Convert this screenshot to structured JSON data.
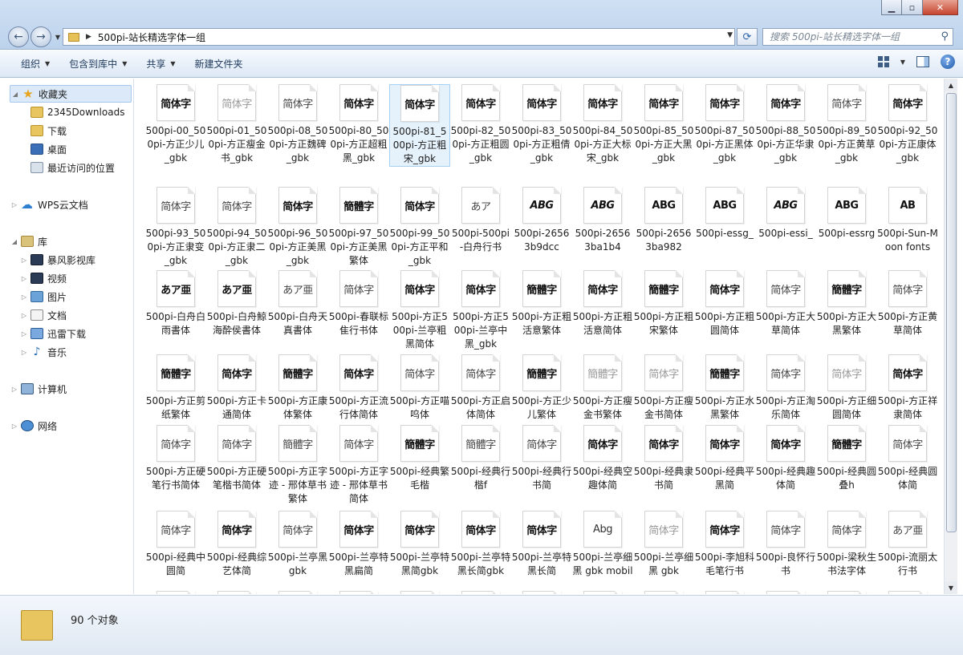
{
  "window": {
    "path_title": "500pi-站长精选字体一组",
    "search_placeholder": "搜索 500pi-站长精选字体一组"
  },
  "toolbar": {
    "organize": "组织",
    "include_in_library": "包含到库中",
    "share": "共享",
    "new_folder": "新建文件夹"
  },
  "sidebar": {
    "favorites": "收藏夹",
    "fav_items": [
      "2345Downloads",
      "下载",
      "桌面",
      "最近访问的位置"
    ],
    "wps": "WPS云文档",
    "libraries": "库",
    "lib_items": [
      "暴风影视库",
      "视频",
      "图片",
      "文档",
      "迅雷下载",
      "音乐"
    ],
    "computer": "计算机",
    "network": "网络"
  },
  "files": [
    {
      "name": "500pi-00_500pi-方正少儿_gbk",
      "glyph": "简体字",
      "style": ""
    },
    {
      "name": "500pi-01_500pi-方正瘦金书_gbk",
      "glyph": "简体字",
      "style": "light"
    },
    {
      "name": "500pi-08_500pi-方正魏碑_gbk",
      "glyph": "简体字",
      "style": "mid"
    },
    {
      "name": "500pi-80_500pi-方正超粗黑_gbk",
      "glyph": "简体字",
      "style": ""
    },
    {
      "name": "500pi-81_500pi-方正粗宋_gbk",
      "glyph": "简体字",
      "style": ""
    },
    {
      "name": "500pi-82_500pi-方正粗圆_gbk",
      "glyph": "简体字",
      "style": ""
    },
    {
      "name": "500pi-83_500pi-方正粗倩_gbk",
      "glyph": "简体字",
      "style": ""
    },
    {
      "name": "500pi-84_500pi-方正大标宋_gbk",
      "glyph": "简体字",
      "style": ""
    },
    {
      "name": "500pi-85_500pi-方正大黑_gbk",
      "glyph": "简体字",
      "style": ""
    },
    {
      "name": "500pi-87_500pi-方正黑体_gbk",
      "glyph": "简体字",
      "style": ""
    },
    {
      "name": "500pi-88_500pi-方正华隶_gbk",
      "glyph": "简体字",
      "style": ""
    },
    {
      "name": "500pi-89_500pi-方正黄草_gbk",
      "glyph": "简体字",
      "style": "mid"
    },
    {
      "name": "500pi-92_500pi-方正康体_gbk",
      "glyph": "简体字",
      "style": ""
    },
    {
      "name": "500pi-93_500pi-方正隶变_gbk",
      "glyph": "简体字",
      "style": "mid"
    },
    {
      "name": "500pi-94_500pi-方正隶二_gbk",
      "glyph": "简体字",
      "style": "mid"
    },
    {
      "name": "500pi-96_500pi-方正美黑_gbk",
      "glyph": "简体字",
      "style": ""
    },
    {
      "name": "500pi-97_500pi-方正美黑繁体",
      "glyph": "簡體字",
      "style": ""
    },
    {
      "name": "500pi-99_500pi-方正平和_gbk",
      "glyph": "简体字",
      "style": ""
    },
    {
      "name": "500pi-500pi-白舟行书",
      "glyph": "あア",
      "style": "mid"
    },
    {
      "name": "500pi-26563b9dcc",
      "glyph": "ABG",
      "style": "latin"
    },
    {
      "name": "500pi-26563ba1b4",
      "glyph": "ABG",
      "style": "latin"
    },
    {
      "name": "500pi-26563ba982",
      "glyph": "ABG",
      "style": ""
    },
    {
      "name": "500pi-essg_",
      "glyph": "ABG",
      "style": ""
    },
    {
      "name": "500pi-essi_",
      "glyph": "ABG",
      "style": "latin"
    },
    {
      "name": "500pi-essrg",
      "glyph": "ABG",
      "style": ""
    },
    {
      "name": "500pi-Sun-Moon fonts",
      "glyph": "AB",
      "style": ""
    },
    {
      "name": "500pi-白舟白雨書体",
      "glyph": "あア亜",
      "style": ""
    },
    {
      "name": "500pi-白舟鯨海酔侯書体",
      "glyph": "あア亜",
      "style": ""
    },
    {
      "name": "500pi-白舟天真書体",
      "glyph": "あア亜",
      "style": "mid"
    },
    {
      "name": "500pi-春联标隹行书体",
      "glyph": "简体字",
      "style": "mid"
    },
    {
      "name": "500pi-方正500pi-兰亭粗黑简体",
      "glyph": "简体字",
      "style": ""
    },
    {
      "name": "500pi-方正500pi-兰亭中黑_gbk",
      "glyph": "简体字",
      "style": ""
    },
    {
      "name": "500pi-方正粗活意繁体",
      "glyph": "簡體字",
      "style": ""
    },
    {
      "name": "500pi-方正粗活意简体",
      "glyph": "简体字",
      "style": ""
    },
    {
      "name": "500pi-方正粗宋繁体",
      "glyph": "簡體字",
      "style": ""
    },
    {
      "name": "500pi-方正粗圆简体",
      "glyph": "简体字",
      "style": ""
    },
    {
      "name": "500pi-方正大草简体",
      "glyph": "简体字",
      "style": "mid"
    },
    {
      "name": "500pi-方正大黑繁体",
      "glyph": "簡體字",
      "style": ""
    },
    {
      "name": "500pi-方正黄草简体",
      "glyph": "简体字",
      "style": "mid"
    },
    {
      "name": "500pi-方正剪纸繁体",
      "glyph": "簡體字",
      "style": ""
    },
    {
      "name": "500pi-方正卡通简体",
      "glyph": "简体字",
      "style": ""
    },
    {
      "name": "500pi-方正康体繁体",
      "glyph": "簡體字",
      "style": ""
    },
    {
      "name": "500pi-方正流行体简体",
      "glyph": "简体字",
      "style": ""
    },
    {
      "name": "500pi-方正喵呜体",
      "glyph": "简体字",
      "style": "mid"
    },
    {
      "name": "500pi-方正启体简体",
      "glyph": "简体字",
      "style": "mid"
    },
    {
      "name": "500pi-方正少儿繁体",
      "glyph": "簡體字",
      "style": ""
    },
    {
      "name": "500pi-方正瘦金书繁体",
      "glyph": "簡體字",
      "style": "light"
    },
    {
      "name": "500pi-方正瘦金书简体",
      "glyph": "简体字",
      "style": "light"
    },
    {
      "name": "500pi-方正水黑繁体",
      "glyph": "簡體字",
      "style": ""
    },
    {
      "name": "500pi-方正淘乐简体",
      "glyph": "简体字",
      "style": "mid"
    },
    {
      "name": "500pi-方正细圆简体",
      "glyph": "简体字",
      "style": "light"
    },
    {
      "name": "500pi-方正祥隶简体",
      "glyph": "简体字",
      "style": ""
    },
    {
      "name": "500pi-方正硬笔行书简体",
      "glyph": "简体字",
      "style": "mid"
    },
    {
      "name": "500pi-方正硬笔楷书简体",
      "glyph": "简体字",
      "style": "mid"
    },
    {
      "name": "500pi-方正字迹 - 邢体草书繁体",
      "glyph": "簡體字",
      "style": "mid"
    },
    {
      "name": "500pi-方正字迹 - 邢体草书简体",
      "glyph": "简体字",
      "style": "mid"
    },
    {
      "name": "500pi-经典繁毛楷",
      "glyph": "簡體字",
      "style": ""
    },
    {
      "name": "500pi-经典行楷f",
      "glyph": "簡體字",
      "style": "mid"
    },
    {
      "name": "500pi-经典行书简",
      "glyph": "简体字",
      "style": "mid"
    },
    {
      "name": "500pi-经典空趣体简",
      "glyph": "简体字",
      "style": ""
    },
    {
      "name": "500pi-经典隶书简",
      "glyph": "简体字",
      "style": ""
    },
    {
      "name": "500pi-经典平黑简",
      "glyph": "简体字",
      "style": ""
    },
    {
      "name": "500pi-经典趣体简",
      "glyph": "简体字",
      "style": ""
    },
    {
      "name": "500pi-经典圆叠h",
      "glyph": "簡體字",
      "style": ""
    },
    {
      "name": "500pi-经典圆体简",
      "glyph": "简体字",
      "style": "mid"
    },
    {
      "name": "500pi-经典中圆简",
      "glyph": "简体字",
      "style": "mid"
    },
    {
      "name": "500pi-经典综艺体简",
      "glyph": "简体字",
      "style": ""
    },
    {
      "name": "500pi-兰亭黑 gbk",
      "glyph": "简体字",
      "style": "mid"
    },
    {
      "name": "500pi-兰亭特黑扁简",
      "glyph": "简体字",
      "style": ""
    },
    {
      "name": "500pi-兰亭特黑简gbk",
      "glyph": "简体字",
      "style": ""
    },
    {
      "name": "500pi-兰亭特黑长简gbk",
      "glyph": "简体字",
      "style": ""
    },
    {
      "name": "500pi-兰亭特黑长简",
      "glyph": "简体字",
      "style": ""
    },
    {
      "name": "500pi-兰亭细黑 gbk mobil",
      "glyph": "Abg",
      "style": "latin-plain"
    },
    {
      "name": "500pi-兰亭细黑 gbk",
      "glyph": "简体字",
      "style": "light"
    },
    {
      "name": "500pi-李旭科毛笔行书",
      "glyph": "简体字",
      "style": ""
    },
    {
      "name": "500pi-良怀行书",
      "glyph": "简体字",
      "style": "mid"
    },
    {
      "name": "500pi-梁秋生书法字体",
      "glyph": "简体字",
      "style": "mid"
    },
    {
      "name": "500pi-流丽太行书",
      "glyph": "あア亜",
      "style": "mid"
    }
  ],
  "status": {
    "count_text": "90 个对象"
  }
}
